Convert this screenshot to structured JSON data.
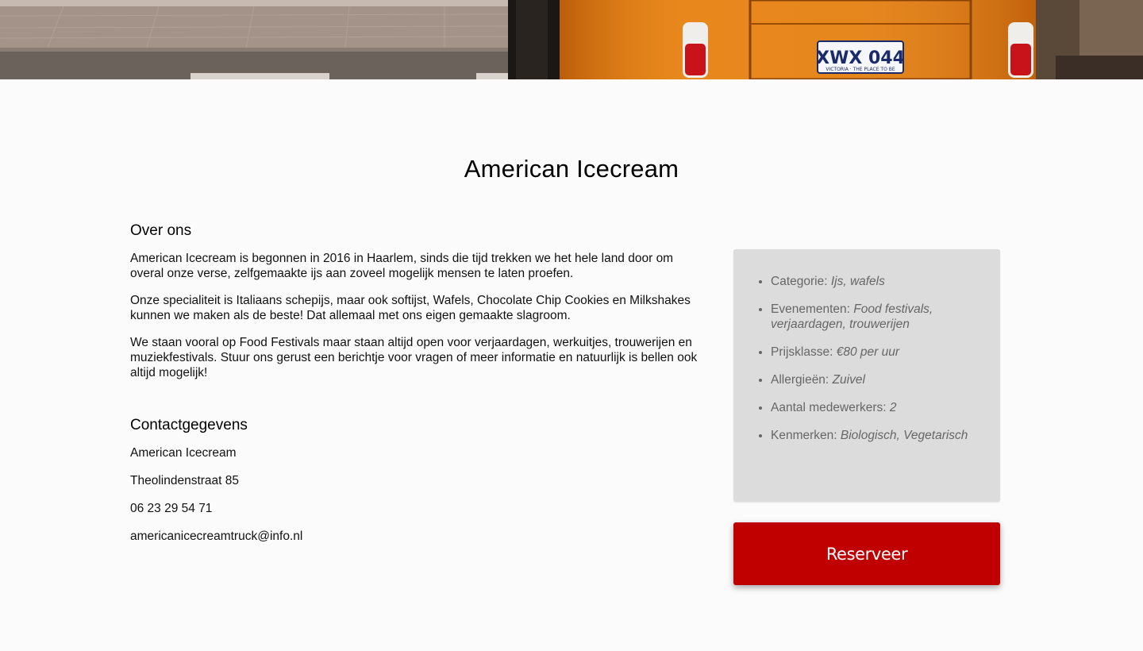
{
  "hero": {
    "plate_text": "XWX 044",
    "plate_subtext": "VICTORIA · THE PLACE TO BE"
  },
  "page_title": "American Icecream",
  "about": {
    "heading": "Over ons",
    "paragraphs": [
      "American Icecream is begonnen in 2016 in Haarlem, sinds die tijd trekken we het hele land door om overal onze verse, zelfgemaakte ijs aan zoveel mogelijk mensen te laten proefen.",
      "Onze specialiteit is Italiaans schepijs, maar ook softijst, Wafels, Chocolate Chip Cookies en Milkshakes kunnen we maken als de beste! Dat allemaal met ons eigen gemaakte slagroom.",
      "We staan vooral op Food Festivals maar staan altijd open voor verjaardagen, werkuitjes, trouwerijen en muziekfestivals. Stuur ons gerust een berichtje voor vragen of meer informatie en natuurlijk is bellen ook altijd mogelijk!"
    ]
  },
  "contact": {
    "heading": "Contactgegevens",
    "name": "American Icecream",
    "address": "Theolindenstraat 85",
    "phone": "06 23 29 54 71",
    "email": "americanicecreamtruck@info.nl"
  },
  "details": [
    {
      "label": "Categorie:",
      "value": "Ijs, wafels"
    },
    {
      "label": "Evenementen:",
      "value": "Food festivals, verjaardagen, trouwerijen"
    },
    {
      "label": "Prijsklasse:",
      "value": "€80 per uur"
    },
    {
      "label": "Allergieën:",
      "value": "Zuivel"
    },
    {
      "label": "Aantal medewerkers:",
      "value": "2"
    },
    {
      "label": "Kenmerken:",
      "value": "Biologisch, Vegetarisch"
    }
  ],
  "reserve_button": "Reserveer",
  "colors": {
    "accent_red": "#c00000",
    "card_gray": "#dcdcdc",
    "truck_orange": "#e8861a"
  }
}
